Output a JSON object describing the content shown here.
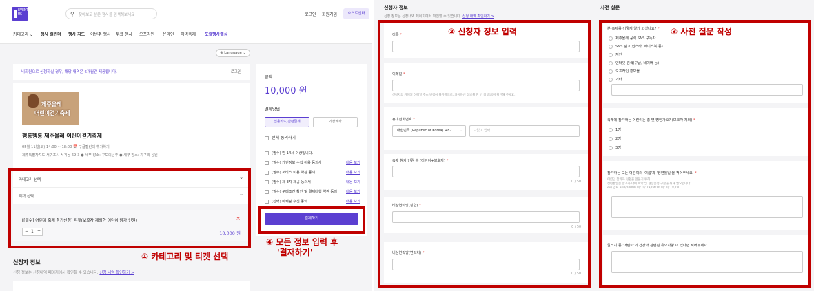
{
  "header": {
    "logo_text": "EVENT\nUS",
    "search_placeholder": "찾아보고 싶은 행사를 검색해보세요",
    "login": "로그인",
    "signup": "회원가입",
    "host_center": "호스트센터"
  },
  "nav": {
    "items": [
      "카테고리 ⌄",
      "행사 캘린더",
      "행사 지도",
      "이번주 행사",
      "무료 행사",
      "오프라인",
      "온라인",
      "지역축제",
      "포캘행사캘심"
    ]
  },
  "language": "⊕ Language ⌄",
  "notice": {
    "text": "비회원으로 신청하실 경우, 해당 내역은 6개월간 제공됩니다.",
    "link": "로그인"
  },
  "event": {
    "thumb_line1": "제주올레",
    "thumb_line2": "어린이걷기축제",
    "title": "펭롱펭롱 제주올레 어린이걷기축제",
    "date": "05월 11일(토) 14:00 ~ 18:00   📅 구글캘린더 추가하기",
    "place": "제주특별자치도 서귀포시 서귀동 69-3 ● 세부 장소: 구도의공주 ● 세부 장소: 자구리 공원"
  },
  "selects": {
    "category": "카테고리 선택",
    "ticket": "티켓 선택"
  },
  "ticket": {
    "name": "[[필수] 어린이 축제 참가신청] 티켓(보호자 제외한 어린이 참가 인원)",
    "close": "×",
    "minus": "−",
    "qty": "1",
    "plus": "+",
    "price": "10,000 원"
  },
  "applicant": {
    "title": "신청자 정보",
    "sub": "신청 정보는 신청내역 페이지에서 확인할 수 있습니다.",
    "link": "신청 내역 확인하기 >"
  },
  "payment": {
    "amount_label": "금액",
    "amount": "10,000 원",
    "method_label": "결제방법",
    "method_card": "신용카드/간편결제",
    "method_bank": "가상계좌",
    "agree_all": "전체 동의하기",
    "agreements": [
      {
        "text": "(필수) 만 14세 이상입니다.",
        "link": ""
      },
      {
        "text": "(필수) 개인정보 수집 이용 동의서",
        "link": "내용 보기"
      },
      {
        "text": "(필수) 서비스 이용 약관 동의",
        "link": "내용 보기"
      },
      {
        "text": "(필수) 제 3자 제공 동의서",
        "link": "내용 보기"
      },
      {
        "text": "(필수) 구매조건 확인 및 결제대행 약관 동의",
        "link": "내용 보기"
      },
      {
        "text": "(선택) 마케팅 수신 동의",
        "link": "내용 보기"
      }
    ],
    "pay_button": "결제하기"
  },
  "annotations": {
    "a1": "① 카테고리 및 티켓 선택",
    "a2": "② 신청자 정보 입력",
    "a3": "③ 사전 질문 작성",
    "a4_line1": "④ 모든 정보 입력 후",
    "a4_line2": "'결재하기'"
  },
  "form": {
    "title": "신청자 정보",
    "sub": "신청 정보는 신청내역 페이지에서 확인할 수 있습니다.",
    "link": "신청 내역 확인하기 >",
    "name_label": "이름",
    "email_label": "이메일",
    "email_hint": "신청자의 카메일 이메일 주소 변경이 불가하므로, 가성자신 정보를 한 번 더 꼼꼼히 확인해 주세요.",
    "phone_label": "휴대전화번호",
    "country": "대한민국 (Republic of Korea) +82",
    "phone_placeholder": "- 없이 입력",
    "q1_label": "축제 참가 인원 수 (어린이+보호자)",
    "q1_count": "0 / 50",
    "q2_label": "비상연락망(성함)",
    "q2_count": "0 / 50",
    "q3_label": "비상연락망(연락처)",
    "q3_count": "0 / 50",
    "req": "*"
  },
  "survey": {
    "title": "사전 설문",
    "q1": "본 축제를 어떻게 알게 되셨나요?",
    "q1_options": [
      "제주올레 공식 SNS 구독자",
      "SNS 광고(인스타, 페이스북 등)",
      "지인",
      "인터넷 검색(구글, 네이버 등)",
      "오프라인 홍보물",
      "기타"
    ],
    "q2": "축제에 참가하는 어린이는 총 몇 명인가요? (보호자 제외)",
    "q2_options": [
      "1명",
      "2명",
      "3명"
    ],
    "q3": "참가하는 모든 어린이의 '이름'과 '생년월일'을 적어주세요.",
    "q3_hint1": "어렸던 참가자 현황을 만들기 위해",
    "q3_hint2": "생년월일은 참가자 나이 파악 및 현장운영 구분을 위해 필요합니다.",
    "q3_hint3": "ex) 양서 910/20090 이/ 이/ 19/04/10 이/ 이/ (오/01)",
    "q4": "알러지 등 '어린이'의 건강과 관련된 유의사항 이 있다면 적어주세요."
  }
}
